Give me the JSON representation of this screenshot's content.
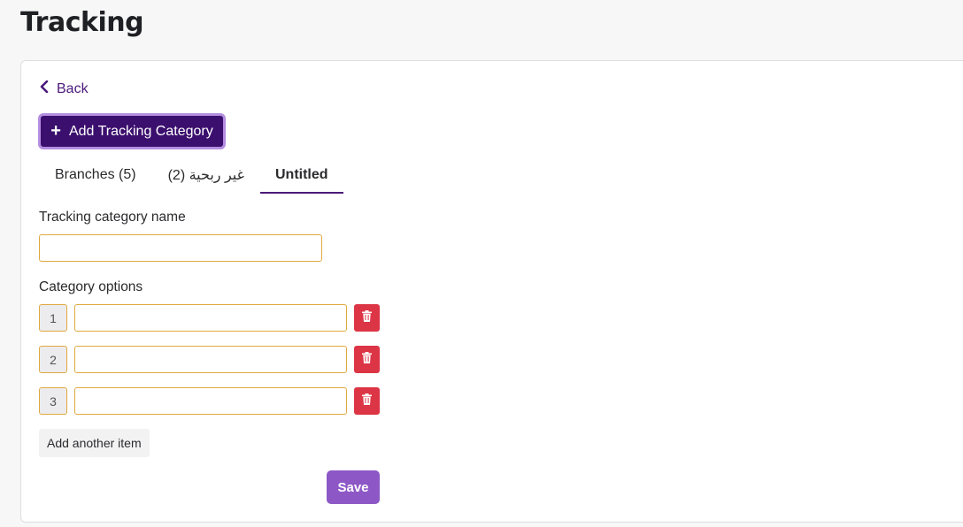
{
  "page": {
    "title": "Tracking"
  },
  "back": {
    "label": "Back"
  },
  "toolbar": {
    "add_category_label": "Add Tracking Category"
  },
  "tabs": [
    {
      "label": "Branches (5)",
      "active": false
    },
    {
      "label": "غير ربحية (2)",
      "active": false
    },
    {
      "label": "Untitled",
      "active": true
    }
  ],
  "form": {
    "name_label": "Tracking category name",
    "name_value": "",
    "options_label": "Category options",
    "options": [
      {
        "number": "1",
        "value": ""
      },
      {
        "number": "2",
        "value": ""
      },
      {
        "number": "3",
        "value": ""
      }
    ],
    "add_item_label": "Add another item",
    "save_label": "Save"
  },
  "colors": {
    "accent": "#3b0f6e",
    "tab_underline": "#4b1a7a",
    "input_border": "#e0a93f",
    "delete": "#dc3545",
    "save": "#8d58c6"
  },
  "icons": {
    "back": "chevron-left-icon",
    "add": "plus-icon",
    "delete": "trash-icon"
  }
}
